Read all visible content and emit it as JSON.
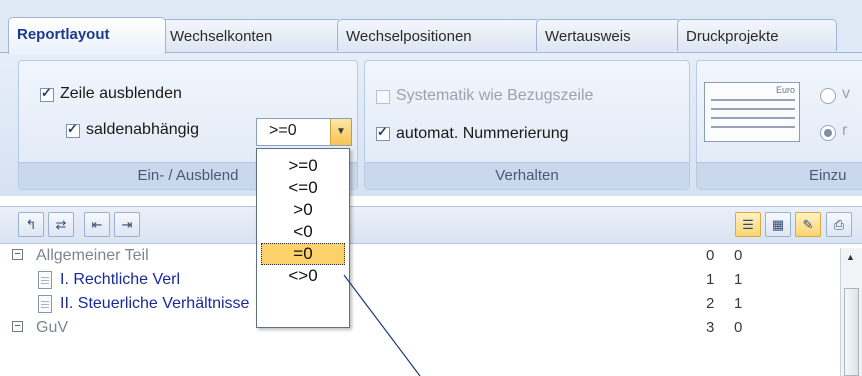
{
  "tabs": [
    "Reportlayout",
    "Wechselkonten",
    "Wechselpositionen",
    "Wertausweis",
    "Druckprojekte"
  ],
  "ribbon": {
    "group1": {
      "zeile_ausblenden": "Zeile ausblenden",
      "saldenabhaengig": "saldenabhängig",
      "combo_value": ">=0",
      "footer": "Ein- / Ausblend"
    },
    "group2": {
      "systematik": "Systematik wie Bezugszeile",
      "nummerierung": "automat. Nummerierung",
      "footer": "Verhalten"
    },
    "group3": {
      "thumb_label": "Euro",
      "radio1": "v",
      "radio2": "r",
      "footer": "Einzu"
    }
  },
  "dropdown": {
    "options": [
      ">=0",
      "<=0",
      ">0",
      "<0",
      "=0",
      "<>0"
    ],
    "selected_index": 4
  },
  "tree": {
    "rows": [
      {
        "label": "Allgemeiner Teil",
        "col1": "0",
        "col2": "0"
      },
      {
        "label": "I. Rechtliche Verl",
        "col1": "1",
        "col2": "1"
      },
      {
        "label": "II. Steuerliche Verhältnisse",
        "col1": "2",
        "col2": "1"
      },
      {
        "label": "GuV",
        "col1": "3",
        "col2": "0"
      }
    ]
  },
  "colors": {
    "accent": "#1b3c8c",
    "selection": "#fbd26a",
    "link_text": "#1a2a9a"
  }
}
